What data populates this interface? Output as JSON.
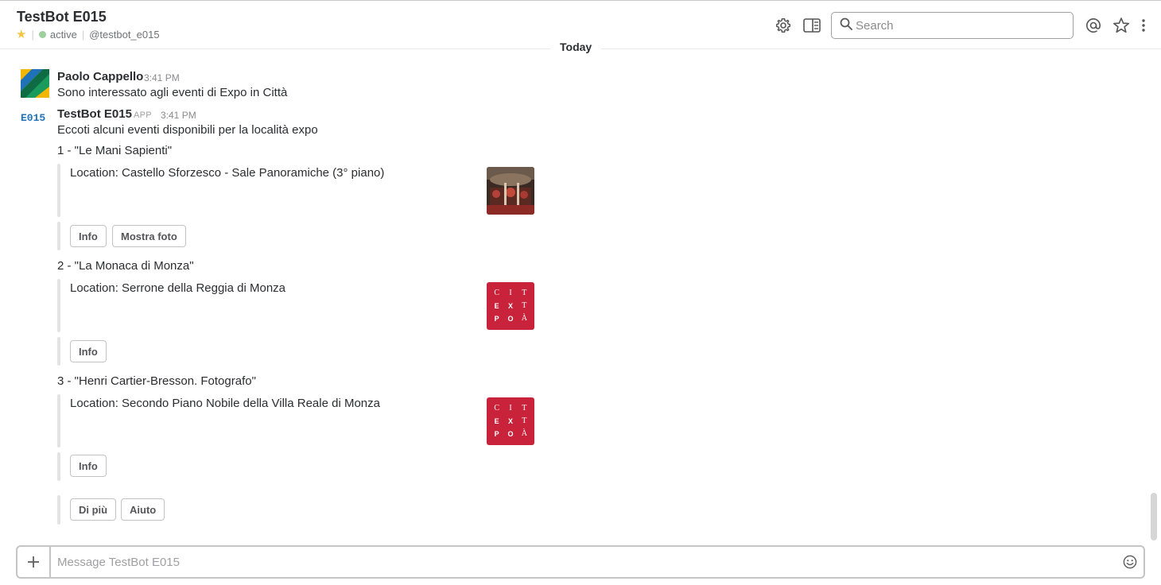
{
  "header": {
    "title": "TestBot E015",
    "status": "active",
    "handle": "@testbot_e015",
    "search_placeholder": "Search",
    "icons": [
      "gear-icon",
      "sidebar-toggle-icon",
      "search-icon",
      "mentions-icon",
      "star-icon",
      "more-icon"
    ]
  },
  "divider": {
    "label": "Today"
  },
  "messages": [
    {
      "author": "Paolo Cappello",
      "time": "3:41 PM",
      "text": "Sono interessato agli eventi di Expo in Città"
    },
    {
      "author": "TestBot E015",
      "avatar_text": "E015",
      "badge": "APP",
      "time": "3:41 PM",
      "intro": "Eccoti alcuni eventi disponibili per la località expo",
      "events": [
        {
          "title": "1 - \"Le Mani Sapienti\"",
          "location": "Location: Castello Sforzesco - Sale Panoramiche (3° piano)",
          "buttons": [
            "Info",
            "Mostra foto"
          ]
        },
        {
          "title": "2 - \"La Monaca di Monza\"",
          "location": "Location: Serrone della Reggia di Monza",
          "buttons": [
            "Info"
          ]
        },
        {
          "title": "3 - \"Henri Cartier-Bresson. Fotografo\"",
          "location": "Location: Secondo Piano Nobile della Villa Reale di Monza",
          "buttons": [
            "Info"
          ]
        }
      ],
      "footer_buttons": [
        "Di più",
        "Aiuto"
      ],
      "expo_logo": [
        "C",
        "I",
        "T",
        "E",
        "X",
        "T",
        "P",
        "O",
        "À"
      ]
    }
  ],
  "composer": {
    "placeholder": "Message TestBot E015"
  },
  "colors": {
    "expo_red": "#c9223b",
    "active_dot": "#9ecf9e",
    "star_yellow": "#f2c744",
    "bot_avatar_blue": "#1f72b8"
  }
}
